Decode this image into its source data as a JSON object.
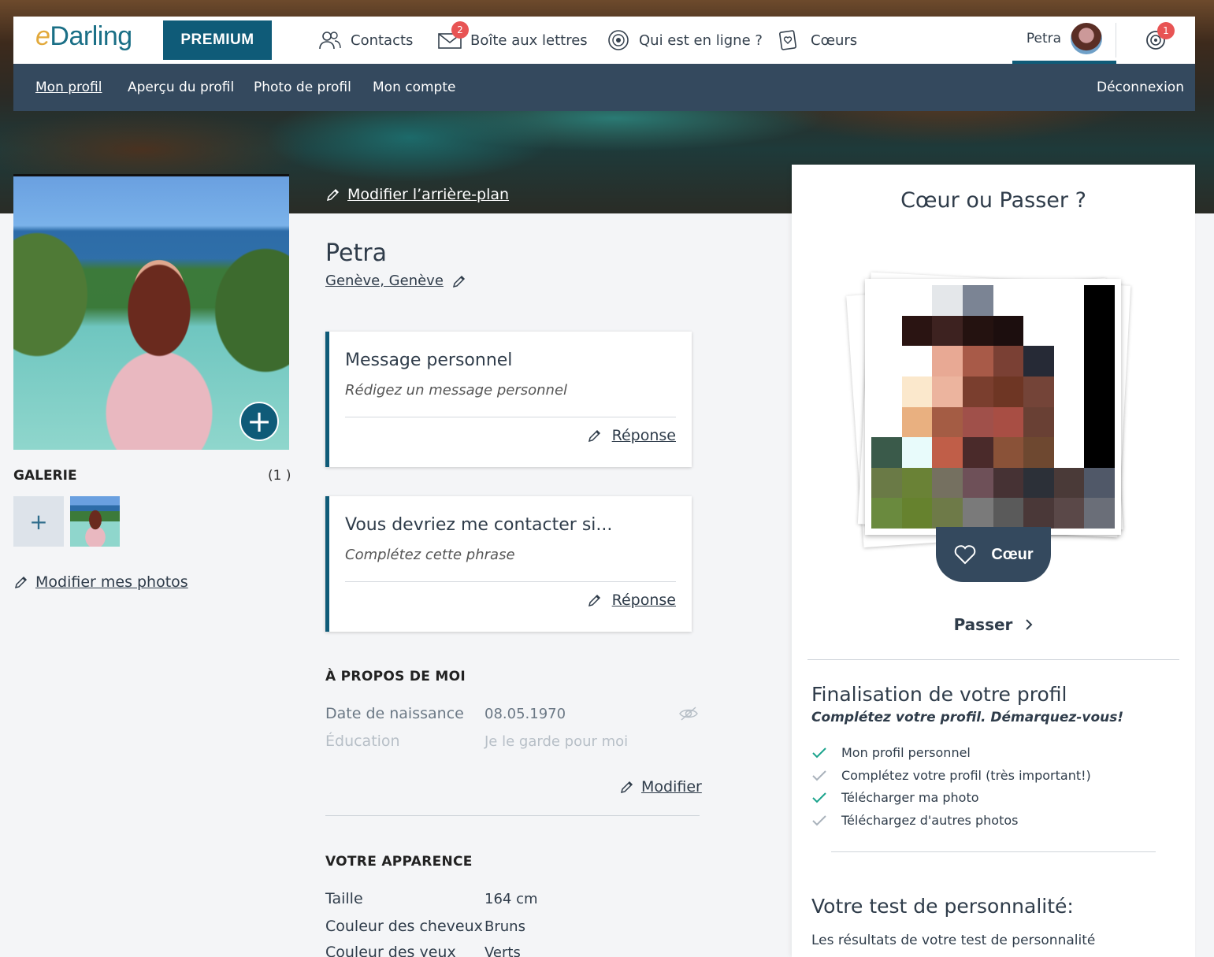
{
  "header": {
    "logo_prefix": "e",
    "logo_rest": "Darling",
    "premium": "PREMIUM",
    "nav": [
      {
        "label": "Contacts",
        "icon": "contacts-icon"
      },
      {
        "label": "Boîte aux lettres",
        "icon": "mail-icon",
        "badge": "2"
      },
      {
        "label": "Qui est en ligne ?",
        "icon": "online-icon"
      },
      {
        "label": "Cœurs",
        "icon": "hearts-icon"
      }
    ],
    "user_name": "Petra",
    "notification_badge": "1"
  },
  "subnav": {
    "items": [
      "Mon profil",
      "Aperçu du profil",
      "Photo de profil",
      "Mon compte"
    ],
    "logout": "Déconnexion"
  },
  "left": {
    "gallery_title": "GALERIE",
    "gallery_count": "(1 )",
    "edit_photos": "Modifier mes photos"
  },
  "center": {
    "edit_background": "Modifier l’arrière-plan",
    "name": "Petra",
    "location": "Genève, Genève",
    "card1": {
      "title": "Message personnel",
      "placeholder": "Rédigez un message personnel",
      "action": "Réponse"
    },
    "card2": {
      "title": "Vous devriez me contacter si...",
      "placeholder": "Complétez cette phrase",
      "action": "Réponse"
    },
    "about_title": "À PROPOS DE MOI",
    "about_rows": [
      {
        "label": "Date de naissance",
        "value": "08.05.1970"
      },
      {
        "label": "Éducation",
        "value": "Je le garde pour moi"
      }
    ],
    "modify": "Modifier",
    "appearance_title": "VOTRE APPARENCE",
    "appearance_rows": [
      {
        "label": "Taille",
        "value": "164 cm"
      },
      {
        "label": "Couleur des cheveux",
        "value": "Bruns"
      },
      {
        "label": "Couleur des yeux",
        "value": "Verts"
      }
    ]
  },
  "right": {
    "title": "Cœur ou Passer ?",
    "heart_button": "Cœur",
    "pass_button": "Passer",
    "finalize_title": "Finalisation de votre profil",
    "finalize_sub": "Complétez votre profil. Démarquez-vous!",
    "checklist": [
      {
        "label": "Mon profil personnel",
        "done": true
      },
      {
        "label": "Complétez votre profil (très important!)",
        "done": false
      },
      {
        "label": "Télécharger ma photo",
        "done": true
      },
      {
        "label": "Téléchargez d'autres photos",
        "done": false
      }
    ],
    "test_title": "Votre test de personnalité:",
    "test_body": "Les résultats de votre test de personnalité"
  },
  "colors": {
    "brand": "#0f5b78",
    "subnav_bg": "#34495e",
    "badge": "#e85454",
    "check_done": "#1aa38c",
    "check_todo": "#a9b2bb"
  }
}
